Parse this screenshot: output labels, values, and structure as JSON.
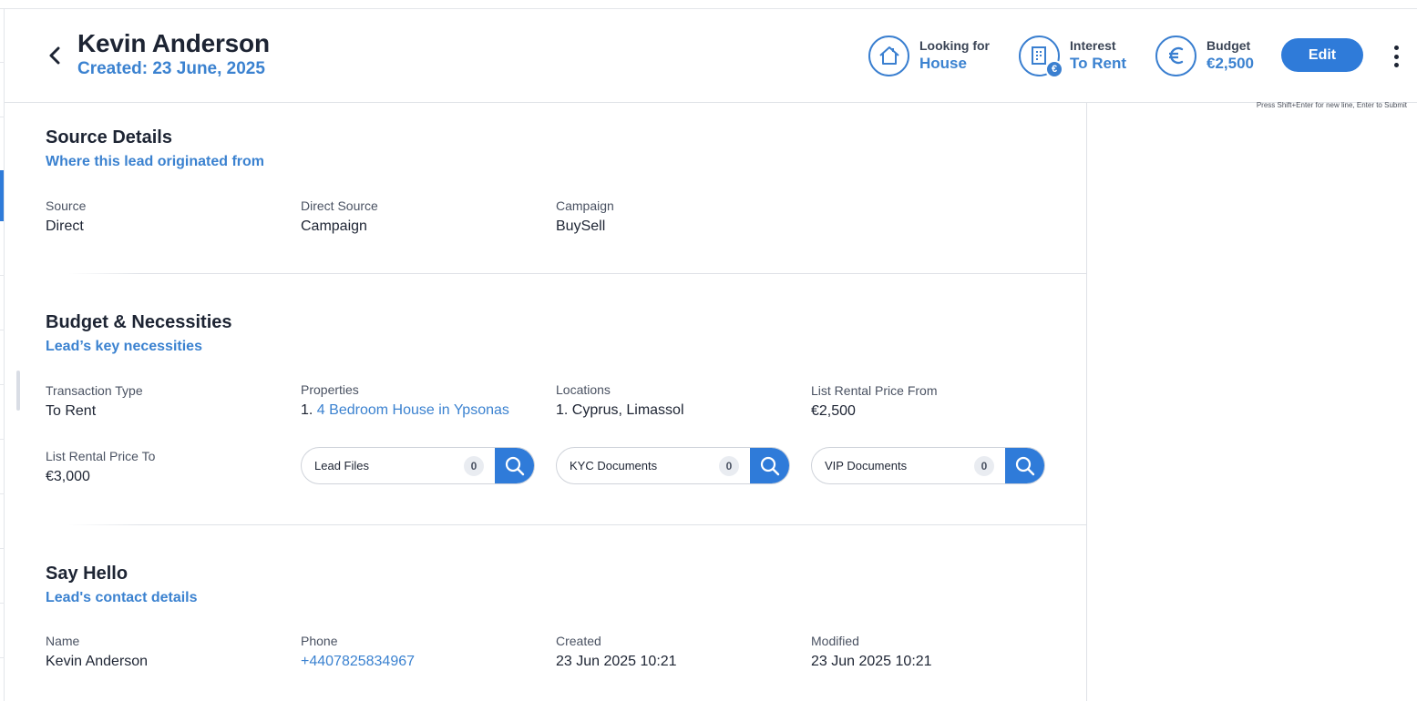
{
  "header": {
    "name": "Kevin Anderson",
    "created": "Created: 23 June, 2025",
    "looking_for": {
      "label": "Looking for",
      "value": "House"
    },
    "interest": {
      "label": "Interest",
      "value": "To Rent"
    },
    "budget": {
      "label": "Budget",
      "value": "€2,500"
    },
    "edit_label": "Edit",
    "euro_badge": "€"
  },
  "hint": "Press Shift+Enter for new line, Enter to Submit",
  "source_details": {
    "title": "Source Details",
    "subtitle": "Where this lead originated from",
    "fields": [
      {
        "label": "Source",
        "value": "Direct"
      },
      {
        "label": "Direct Source",
        "value": "Campaign"
      },
      {
        "label": "Campaign",
        "value": "BuySell"
      }
    ]
  },
  "budget_necessities": {
    "title": "Budget & Necessities",
    "subtitle": "Lead’s key necessities",
    "transaction_type": {
      "label": "Transaction Type",
      "value": "To Rent"
    },
    "properties": {
      "label": "Properties",
      "number": "1.",
      "value": "4 Bedroom House in Ypsonas"
    },
    "locations": {
      "label": "Locations",
      "value": "1. Cyprus, Limassol"
    },
    "price_from": {
      "label": "List Rental Price From",
      "value": "€2,500"
    },
    "price_to": {
      "label": "List Rental Price To",
      "value": "€3,000"
    },
    "documents": [
      {
        "name": "Lead Files",
        "count": "0"
      },
      {
        "name": "KYC Documents",
        "count": "0"
      },
      {
        "name": "VIP Documents",
        "count": "0"
      }
    ]
  },
  "say_hello": {
    "title": "Say Hello",
    "subtitle": "Lead's contact details",
    "name": {
      "label": "Name",
      "value": "Kevin Anderson"
    },
    "phone": {
      "label": "Phone",
      "value": "+4407825834967"
    },
    "created": {
      "label": "Created",
      "value": "23 Jun 2025 10:21"
    },
    "modified": {
      "label": "Modified",
      "value": "23 Jun 2025 10:21"
    }
  },
  "colors": {
    "accent": "#2f7bd9",
    "link": "#3b82d0",
    "text": "#1d2433"
  }
}
